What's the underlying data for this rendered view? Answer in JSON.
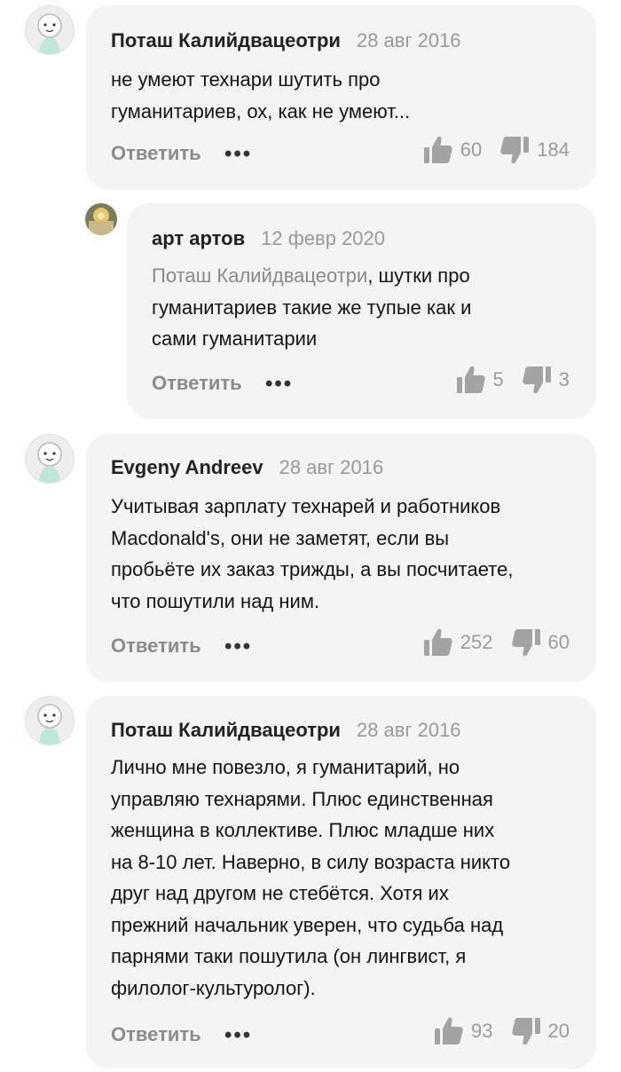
{
  "ui": {
    "reply_label": "Ответить",
    "more_label": "•••"
  },
  "comments": [
    {
      "author": "Поташ Калийдвацеотри",
      "date": "28 авг 2016",
      "lines": [
        "не умеют технари шутить про",
        "гуманитариев, ох, как не умеют..."
      ],
      "likes": "60",
      "dislikes": "184"
    },
    {
      "author": "арт артов",
      "date": "12 февр 2020",
      "mention": "Поташ Калийдвацеотри",
      "lines": [
        ", шутки про",
        "гуманитариев такие же тупые как и",
        "сами гуманитарии"
      ],
      "likes": "5",
      "dislikes": "3"
    },
    {
      "author": "Evgeny Andreev",
      "date": "28 авг 2016",
      "lines": [
        "Учитывая зарплату технарей и работников",
        "Macdonald's, они не заметят, если вы",
        "пробьёте их заказ трижды, а вы посчитаете,",
        "что пошутили над ним."
      ],
      "likes": "252",
      "dislikes": "60"
    },
    {
      "author": "Поташ Калийдвацеотри",
      "date": "28 авг 2016",
      "lines": [
        "Лично мне повезло, я гуманитарий, но",
        "управляю технарями. Плюс единственная",
        "женщина в коллективе. Плюс младше них",
        "на 8-10 лет. Наверно, в силу возраста никто",
        "друг над другом не стебётся. Хотя их",
        "прежний начальник уверен, что судьба над",
        "парнями таки пошутила (он лингвист, я",
        "филолог-культуролог)."
      ],
      "likes": "93",
      "dislikes": "20"
    }
  ]
}
